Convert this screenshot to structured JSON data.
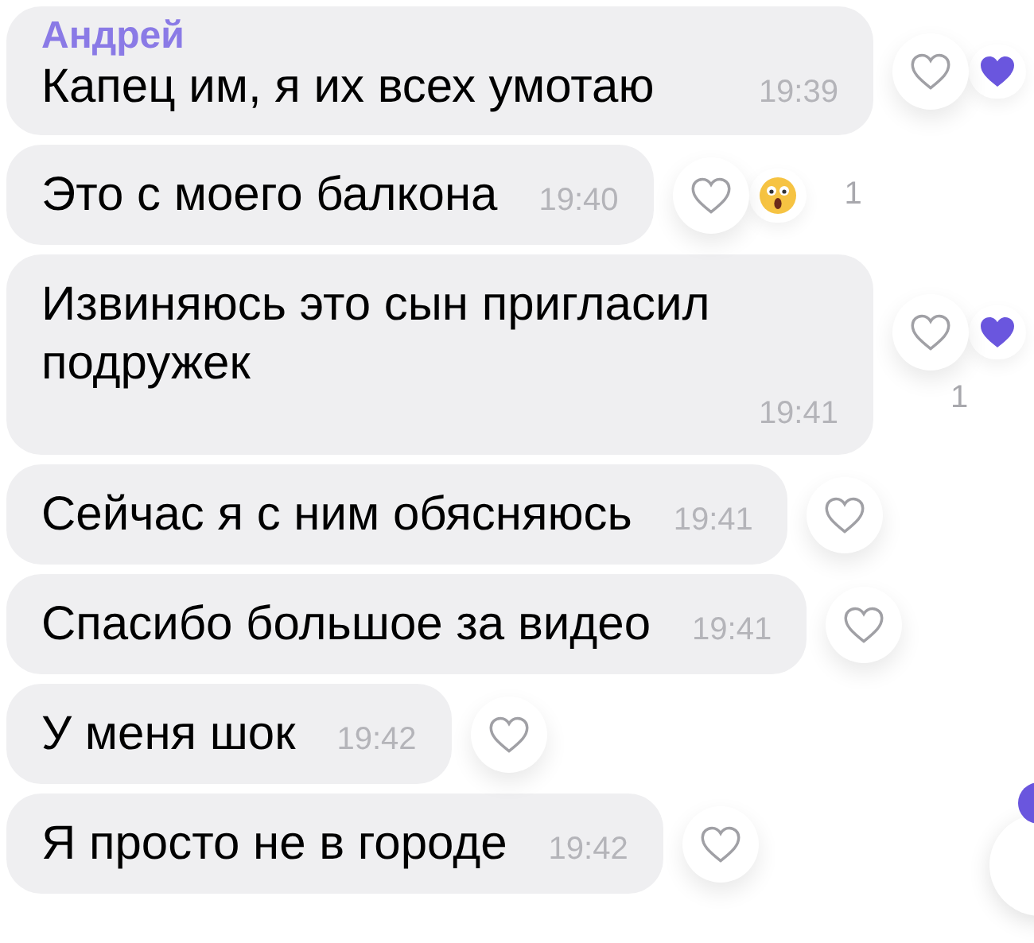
{
  "messages": [
    {
      "sender": "Андрей",
      "text": "Капец им, я их всех умотаю",
      "time": "19:39",
      "reaction": {
        "kind": "heart"
      }
    },
    {
      "text": "Это с моего балкона",
      "time": "19:40",
      "reaction": {
        "kind": "surprised",
        "count": "1",
        "count_below": false
      }
    },
    {
      "text": "Извиняюсь это сын пригласил подружек",
      "time": "19:41",
      "reaction": {
        "kind": "heart",
        "count": "1",
        "count_below": true
      }
    },
    {
      "text": "Сейчас я с ним обясняюсь",
      "time": "19:41"
    },
    {
      "text": "Спасибо большое за видео",
      "time": "19:41"
    },
    {
      "text": "У меня шок",
      "time": "19:42"
    },
    {
      "text": "Я просто не в городе",
      "time": "19:42"
    }
  ]
}
